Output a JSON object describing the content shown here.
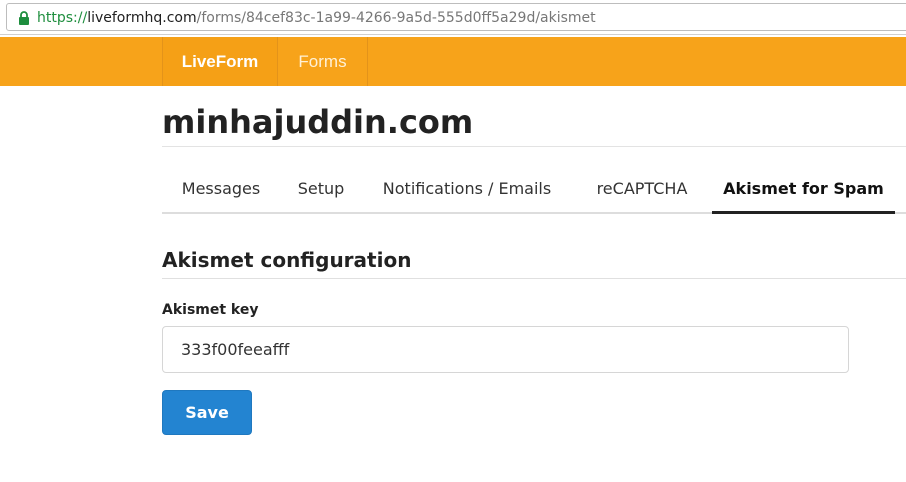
{
  "browser": {
    "url_scheme": "https://",
    "url_host": "liveformhq.com",
    "url_path": "/forms/84cef83c-1a99-4266-9a5d-555d0ff5a29d/akismet",
    "lock_icon": "lock-icon",
    "secure_color": "#1e8e3e"
  },
  "nav": {
    "brand": "LiveForm",
    "forms": "Forms",
    "color": "#f7a31a"
  },
  "page": {
    "site_title": "minhajuddin.com"
  },
  "tabs": [
    {
      "label": "Messages",
      "active": false
    },
    {
      "label": "Setup",
      "active": false
    },
    {
      "label": "Notifications / Emails",
      "active": false
    },
    {
      "label": "reCAPTCHA",
      "active": false
    },
    {
      "label": "Akismet for Spam",
      "active": true
    }
  ],
  "section": {
    "title": "Akismet configuration",
    "key_label": "Akismet key",
    "key_value": "333f00feeafff"
  },
  "actions": {
    "save_label": "Save",
    "save_color": "#2384d1"
  }
}
